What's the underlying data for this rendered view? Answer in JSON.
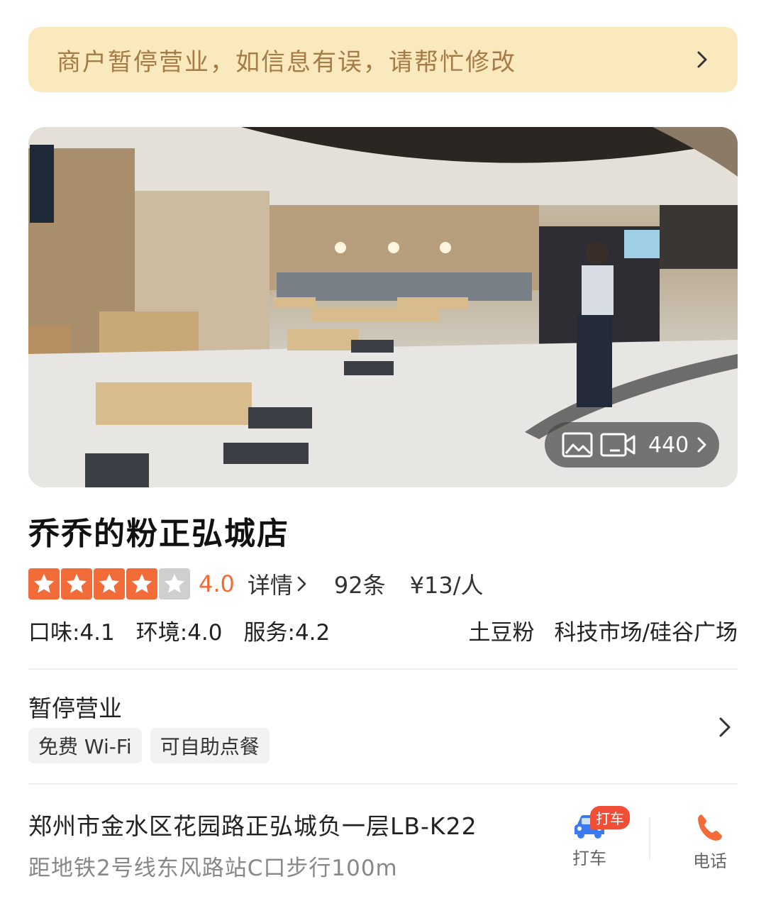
{
  "notice": {
    "text": "商户暂停营业，如信息有误，请帮忙修改"
  },
  "hero": {
    "media_count": "440"
  },
  "shop": {
    "name": "乔乔的粉正弘城店",
    "rating": {
      "stars": 4,
      "max_stars": 5,
      "score": "4.0"
    },
    "detail_label": "详情",
    "reviews": "92条",
    "price": "¥13/人",
    "sub_scores": {
      "taste": "口味:4.1",
      "environment": "环境:4.0",
      "service": "服务:4.2"
    },
    "category": "土豆粉",
    "district": "科技市场/硅谷广场"
  },
  "business": {
    "status": "暂停营业",
    "tags": [
      "免费 Wi-Fi",
      "可自助点餐"
    ]
  },
  "location": {
    "address": "郑州市金水区花园路正弘城负一层LB-K22",
    "distance": "距地铁2号线东风路站C口步行100m"
  },
  "actions": {
    "taxi_badge": "打车",
    "taxi_label": "打车",
    "phone_label": "电话"
  },
  "colors": {
    "accent": "#f26c3a",
    "notice_bg": "#fbe9be",
    "notice_text": "#a57b48",
    "badge": "#f04e36",
    "taxi_icon": "#3a7bf0"
  }
}
